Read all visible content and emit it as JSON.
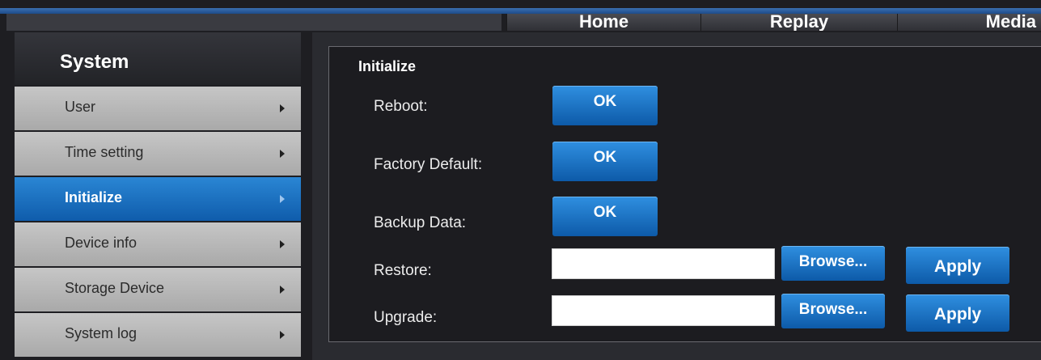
{
  "topnav": {
    "items": [
      {
        "label": "Home"
      },
      {
        "label": "Replay"
      },
      {
        "label": "Media"
      }
    ]
  },
  "sidebar": {
    "title": "System",
    "items": [
      {
        "label": "User",
        "active": false
      },
      {
        "label": "Time setting",
        "active": false
      },
      {
        "label": "Initialize",
        "active": true
      },
      {
        "label": "Device info",
        "active": false
      },
      {
        "label": "Storage Device",
        "active": false
      },
      {
        "label": "System log",
        "active": false
      }
    ]
  },
  "panel": {
    "title": "Initialize",
    "reboot_label": "Reboot:",
    "factory_label": "Factory Default:",
    "backup_label": "Backup Data:",
    "restore_label": "Restore:",
    "upgrade_label": "Upgrade:",
    "ok_label": "OK",
    "browse_label": "Browse...",
    "apply_label": "Apply",
    "restore_value": "",
    "upgrade_value": ""
  },
  "colors": {
    "accent": "#0f5cab",
    "nav_line": "#2d5fa3",
    "sidebar_item": "#b8b8b8"
  }
}
